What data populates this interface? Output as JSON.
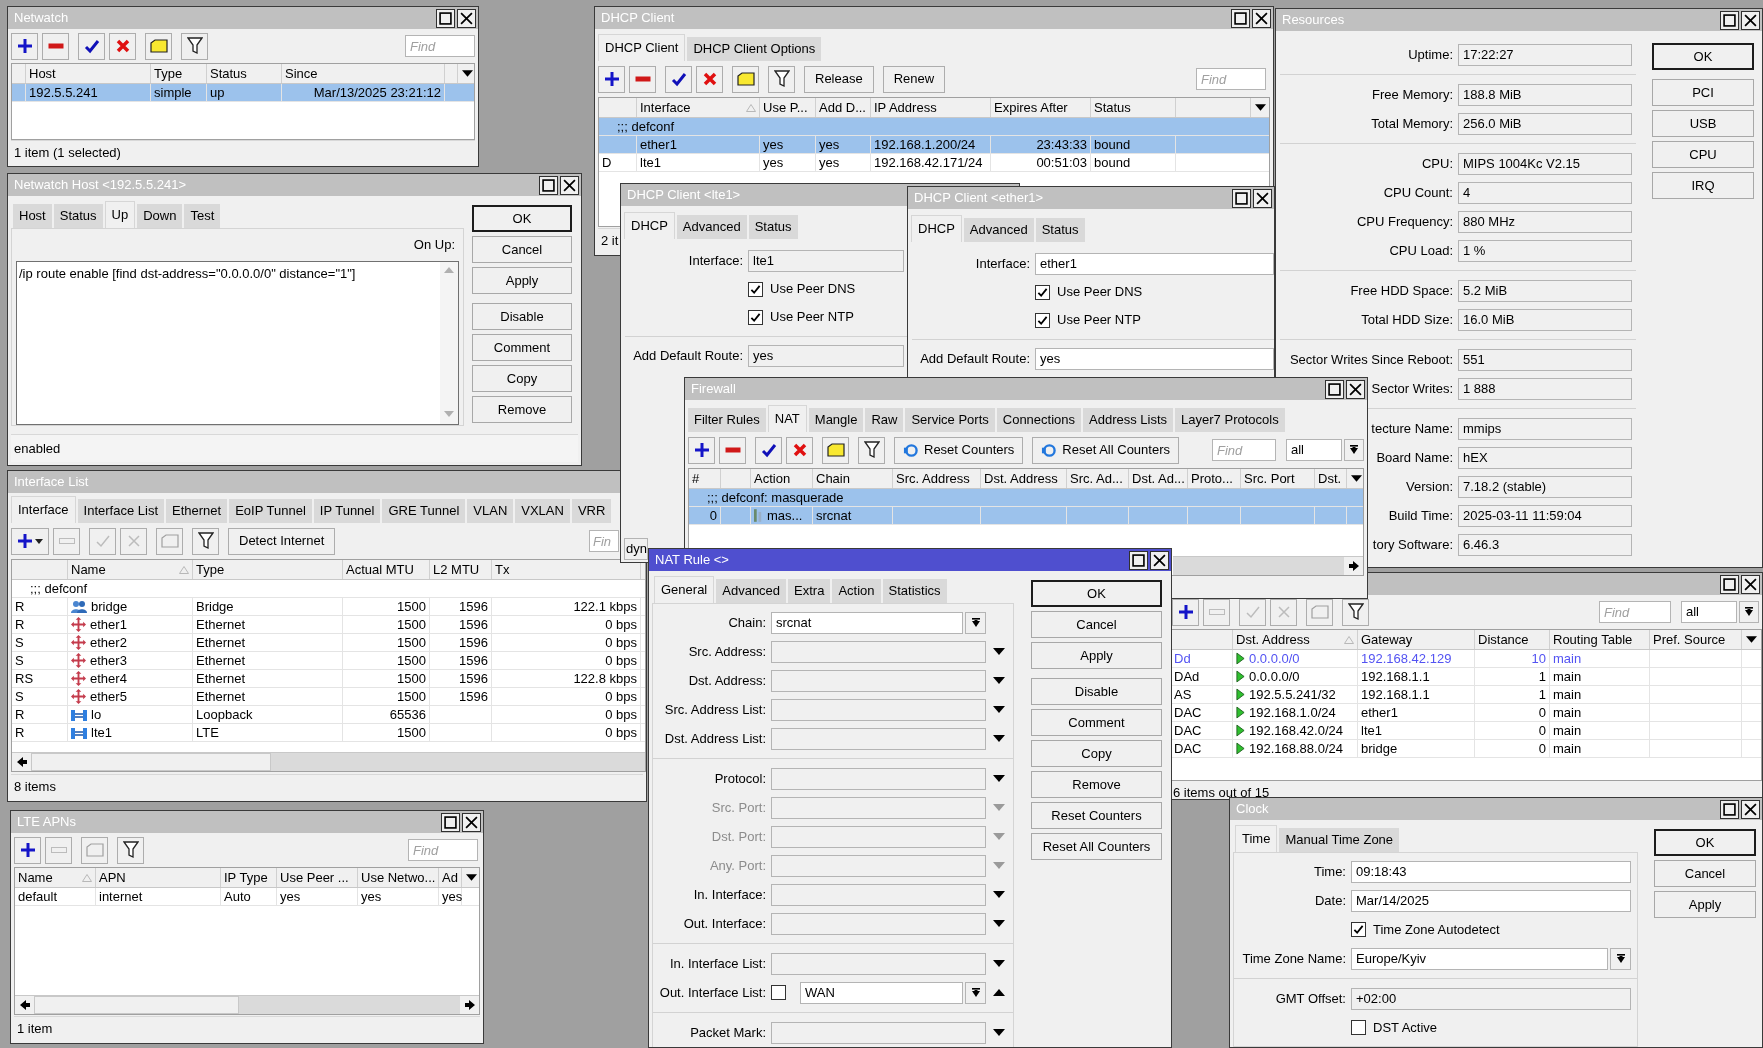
{
  "netwatch": {
    "title": "Netwatch",
    "active": false,
    "toolbar": [
      {
        "kind": "add",
        "disabled": false
      },
      {
        "kind": "remove",
        "disabled": false
      },
      {
        "kind": "enable",
        "disabled": false
      },
      {
        "kind": "disable",
        "disabled": false
      },
      {
        "kind": "comment",
        "disabled": false
      },
      {
        "kind": "filter",
        "disabled": false
      }
    ],
    "find": {
      "placeholder": "Find"
    },
    "columns": [
      {
        "label": "Host",
        "sorted": false
      },
      {
        "label": "Type",
        "sorted": false
      },
      {
        "label": "Status",
        "sorted": false
      },
      {
        "label": "Since",
        "sorted": false
      }
    ],
    "rows": [
      {
        "selected": true,
        "host": "192.5.5.241",
        "type": "simple",
        "status": "up",
        "since": "Mar/13/2025 23:21:12"
      }
    ],
    "status": "1 item (1 selected)"
  },
  "netwatch_host": {
    "title": "Netwatch Host <192.5.5.241>",
    "active": false,
    "tabs": [
      {
        "label": "Host",
        "selected": false
      },
      {
        "label": "Status",
        "selected": false
      },
      {
        "label": "Up",
        "selected": true
      },
      {
        "label": "Down",
        "selected": false
      },
      {
        "label": "Test",
        "selected": false
      }
    ],
    "script": {
      "label": "On Up:",
      "value": "/ip route enable [find dst-address=\"0.0.0.0/0\" distance=\"1\"]"
    },
    "buttons": [
      {
        "label": "OK",
        "default": true
      },
      {
        "label": "Cancel",
        "default": false
      },
      {
        "label": "Apply",
        "default": false
      },
      {
        "label": "Disable",
        "default": false
      },
      {
        "label": "Comment",
        "default": false
      },
      {
        "label": "Copy",
        "default": false
      },
      {
        "label": "Remove",
        "default": false
      }
    ],
    "status": "enabled"
  },
  "dhcp_client": {
    "title": "DHCP Client",
    "active": false,
    "tabs": [
      {
        "label": "DHCP Client",
        "selected": true
      },
      {
        "label": "DHCP Client Options",
        "selected": false
      }
    ],
    "toolbar": [
      {
        "kind": "add",
        "disabled": false
      },
      {
        "kind": "remove",
        "disabled": false
      },
      {
        "kind": "enable",
        "disabled": false
      },
      {
        "kind": "disable",
        "disabled": false
      },
      {
        "kind": "comment",
        "disabled": false
      },
      {
        "kind": "filter",
        "disabled": false
      },
      {
        "kind": "text",
        "label": "Release",
        "disabled": false
      },
      {
        "kind": "text",
        "label": "Renew",
        "disabled": false
      }
    ],
    "find": {
      "placeholder": "Find"
    },
    "columns": [
      {
        "label": "Interface",
        "sorted": true
      },
      {
        "label": "Use P...",
        "sorted": false
      },
      {
        "label": "Add D...",
        "sorted": false
      },
      {
        "label": "IP Address",
        "sorted": false
      },
      {
        "label": "Expires After",
        "sorted": false
      },
      {
        "label": "Status",
        "sorted": false
      }
    ],
    "rows": [
      {
        "kind": "comment",
        "text": ";;; defconf",
        "selected": true
      },
      {
        "kind": "item",
        "selected": true,
        "interface": "ether1",
        "peer": "yes",
        "route": "yes",
        "ip": "192.168.1.200/24",
        "expires": "23:43:33",
        "status": "bound"
      },
      {
        "kind": "item",
        "selected": false,
        "flags": "D",
        "interface": "lte1",
        "peer": "yes",
        "route": "yes",
        "ip": "192.168.42.171/24",
        "expires": "00:51:03",
        "status": "bound"
      }
    ],
    "status": "2 it"
  },
  "interface_list": {
    "title": "Interface List",
    "active": false,
    "tabs": [
      {
        "label": "Interface",
        "selected": true
      },
      {
        "label": "Interface List",
        "selected": false
      },
      {
        "label": "Ethernet",
        "selected": false
      },
      {
        "label": "EoIP Tunnel",
        "selected": false
      },
      {
        "label": "IP Tunnel",
        "selected": false
      },
      {
        "label": "GRE Tunnel",
        "selected": false
      },
      {
        "label": "VLAN",
        "selected": false
      },
      {
        "label": "VXLAN",
        "selected": false
      },
      {
        "label": "VRR",
        "selected": false
      }
    ],
    "toolbar": [
      {
        "kind": "add-menu",
        "disabled": false
      },
      {
        "kind": "remove",
        "disabled": true
      },
      {
        "kind": "enable",
        "disabled": true
      },
      {
        "kind": "disable",
        "disabled": true
      },
      {
        "kind": "comment",
        "disabled": true
      },
      {
        "kind": "filter",
        "disabled": false
      },
      {
        "kind": "text",
        "label": "Detect Internet",
        "disabled": false
      }
    ],
    "find": {
      "placeholder": "Fin"
    },
    "columns": [
      {
        "label": "Name",
        "sorted": true
      },
      {
        "label": "Type",
        "sorted": false
      },
      {
        "label": "Actual MTU",
        "sorted": false
      },
      {
        "label": "L2 MTU",
        "sorted": false
      },
      {
        "label": "Tx",
        "sorted": false
      }
    ],
    "rows": [
      {
        "kind": "comment",
        "text": ";;; defconf",
        "selected": false
      },
      {
        "kind": "bridge",
        "selected": false,
        "flags": "R",
        "name": "bridge",
        "type": "Bridge",
        "mtu": "1500",
        "l2mtu": "1596",
        "tx": "122.1 kbps"
      },
      {
        "kind": "ethernet",
        "selected": false,
        "flags": "R",
        "name": "ether1",
        "type": "Ethernet",
        "mtu": "1500",
        "l2mtu": "1596",
        "tx": "0 bps"
      },
      {
        "kind": "ethernet",
        "selected": false,
        "flags": "S",
        "name": "ether2",
        "type": "Ethernet",
        "mtu": "1500",
        "l2mtu": "1596",
        "tx": "0 bps"
      },
      {
        "kind": "ethernet",
        "selected": false,
        "flags": "S",
        "name": "ether3",
        "type": "Ethernet",
        "mtu": "1500",
        "l2mtu": "1596",
        "tx": "0 bps"
      },
      {
        "kind": "ethernet",
        "selected": false,
        "flags": "RS",
        "name": "ether4",
        "type": "Ethernet",
        "mtu": "1500",
        "l2mtu": "1596",
        "tx": "122.8 kbps"
      },
      {
        "kind": "ethernet",
        "selected": false,
        "flags": "S",
        "name": "ether5",
        "type": "Ethernet",
        "mtu": "1500",
        "l2mtu": "1596",
        "tx": "0 bps"
      },
      {
        "kind": "virtual",
        "selected": false,
        "flags": "R",
        "name": "lo",
        "type": "Loopback",
        "mtu": "65536",
        "tx": "0 bps"
      },
      {
        "kind": "virtual",
        "selected": false,
        "flags": "R",
        "name": "lte1",
        "type": "LTE",
        "mtu": "1500",
        "tx": "0 bps"
      }
    ],
    "status": "8 items"
  },
  "lte_apns": {
    "title": "LTE APNs",
    "active": false,
    "toolbar": [
      {
        "kind": "add",
        "disabled": false
      },
      {
        "kind": "remove",
        "disabled": true
      },
      {
        "kind": "comment",
        "disabled": true
      },
      {
        "kind": "filter",
        "disabled": false
      }
    ],
    "find": {
      "placeholder": "Find"
    },
    "columns": [
      {
        "label": "Name",
        "sorted": true
      },
      {
        "label": "APN",
        "sorted": false
      },
      {
        "label": "IP Type",
        "sorted": false
      },
      {
        "label": "Use Peer ...",
        "sorted": false
      },
      {
        "label": "Use Netwo...",
        "sorted": false
      },
      {
        "label": "Ad",
        "sorted": false
      }
    ],
    "rows": [
      {
        "selected": false,
        "name": "default",
        "apn": "internet",
        "ip_type": "Auto",
        "use_peer": "yes",
        "use_network": "yes",
        "add": "yes"
      }
    ],
    "status": "1 item"
  },
  "dhcp_lte1": {
    "title": "DHCP Client <lte1>",
    "active": false,
    "tabs": [
      {
        "label": "DHCP",
        "selected": true
      },
      {
        "label": "Advanced",
        "selected": false
      },
      {
        "label": "Status",
        "selected": false
      }
    ],
    "sections": [
      {
        "rows": [
          {
            "kind": "text",
            "label": "Interface:",
            "value": "lte1",
            "readonly": true
          },
          {
            "kind": "checkbox",
            "label": "Use Peer DNS",
            "checked": true
          },
          {
            "kind": "checkbox",
            "label": "Use Peer NTP",
            "checked": true
          }
        ]
      },
      {
        "rows": [
          {
            "kind": "text",
            "label": "Add Default Route:",
            "value": "yes",
            "readonly": true
          }
        ]
      }
    ],
    "status": "dyn"
  },
  "dhcp_ether1": {
    "title": "DHCP Client <ether1>",
    "active": false,
    "tabs": [
      {
        "label": "DHCP",
        "selected": true
      },
      {
        "label": "Advanced",
        "selected": false
      },
      {
        "label": "Status",
        "selected": false
      }
    ],
    "sections": [
      {
        "rows": [
          {
            "kind": "text",
            "label": "Interface:",
            "value": "ether1",
            "readonly": false
          },
          {
            "kind": "checkbox",
            "label": "Use Peer DNS",
            "checked": true
          },
          {
            "kind": "checkbox",
            "label": "Use Peer NTP",
            "checked": true
          }
        ]
      },
      {
        "rows": [
          {
            "kind": "text",
            "label": "Add Default Route:",
            "value": "yes",
            "readonly": false
          }
        ]
      }
    ]
  },
  "resources": {
    "title": "Resources",
    "active": false,
    "sections": [
      {
        "rows": [
          {
            "kind": "text",
            "label": "Uptime:",
            "value": "17:22:27",
            "readonly": true
          }
        ]
      },
      {
        "rows": [
          {
            "kind": "text",
            "label": "Free Memory:",
            "value": "188.8 MiB",
            "readonly": true
          },
          {
            "kind": "text",
            "label": "Total Memory:",
            "value": "256.0 MiB",
            "readonly": true
          }
        ]
      },
      {
        "rows": [
          {
            "kind": "text",
            "label": "CPU:",
            "value": "MIPS 1004Kc V2.15",
            "readonly": true
          },
          {
            "kind": "text",
            "label": "CPU Count:",
            "value": "4",
            "readonly": true
          },
          {
            "kind": "text",
            "label": "CPU Frequency:",
            "value": "880 MHz",
            "readonly": true
          },
          {
            "kind": "text",
            "label": "CPU Load:",
            "value": "1 %",
            "readonly": true
          }
        ]
      },
      {
        "rows": [
          {
            "kind": "text",
            "label": "Free HDD Space:",
            "value": "5.2 MiB",
            "readonly": true
          },
          {
            "kind": "text",
            "label": "Total HDD Size:",
            "value": "16.0 MiB",
            "readonly": true
          }
        ]
      },
      {
        "rows": [
          {
            "kind": "text",
            "label": "Sector Writes Since Reboot:",
            "value": "551",
            "readonly": true
          },
          {
            "kind": "text",
            "label": "Sector Writes:",
            "value": "1 888",
            "readonly": true
          }
        ]
      },
      {
        "rows": [
          {
            "kind": "text",
            "label": "tecture Name:",
            "value": "mmips",
            "readonly": true
          },
          {
            "kind": "text",
            "label": "Board Name:",
            "value": "hEX",
            "readonly": true
          },
          {
            "kind": "text",
            "label": "Version:",
            "value": "7.18.2 (stable)",
            "readonly": true
          },
          {
            "kind": "text",
            "label": "Build Time:",
            "value": "2025-03-11 11:59:04",
            "readonly": true
          },
          {
            "kind": "text",
            "label": "tory Software:",
            "value": "6.46.3",
            "readonly": true
          }
        ]
      }
    ],
    "buttons": [
      {
        "label": "OK",
        "default": true
      },
      {
        "label": "PCI",
        "default": false
      },
      {
        "label": "USB",
        "default": false
      },
      {
        "label": "CPU",
        "default": false
      },
      {
        "label": "IRQ",
        "default": false
      }
    ]
  },
  "routes": {
    "active": false,
    "toolbar": [
      {
        "kind": "add",
        "disabled": false
      },
      {
        "kind": "remove",
        "disabled": true
      },
      {
        "kind": "enable",
        "disabled": true
      },
      {
        "kind": "disable",
        "disabled": true
      },
      {
        "kind": "comment",
        "disabled": true
      },
      {
        "kind": "filter",
        "disabled": false
      }
    ],
    "find": {
      "placeholder": "Find"
    },
    "filter": "all",
    "columns": [
      {
        "label": "Dst. Address",
        "sorted": true
      },
      {
        "label": "Gateway",
        "sorted": false
      },
      {
        "label": "Distance",
        "sorted": false
      },
      {
        "label": "Routing Table",
        "sorted": false
      },
      {
        "label": "Pref. Source",
        "sorted": false
      }
    ],
    "rows": [
      {
        "selected": false,
        "color": "#5353f2",
        "flags": "Dd",
        "dst": "0.0.0.0/0",
        "gateway": "192.168.42.129",
        "distance": "10",
        "table": "main"
      },
      {
        "selected": false,
        "color": "#000000",
        "flags": "DAd",
        "dst": "0.0.0.0/0",
        "gateway": "192.168.1.1",
        "distance": "1",
        "table": "main"
      },
      {
        "selected": false,
        "color": "#000000",
        "flags": "AS",
        "dst": "192.5.5.241/32",
        "gateway": "192.168.1.1",
        "distance": "1",
        "table": "main"
      },
      {
        "selected": false,
        "color": "#000000",
        "flags": "DAC",
        "dst": "192.168.1.0/24",
        "gateway": "ether1",
        "distance": "0",
        "table": "main"
      },
      {
        "selected": false,
        "color": "#000000",
        "flags": "DAC",
        "dst": "192.168.42.0/24",
        "gateway": "lte1",
        "distance": "0",
        "table": "main"
      },
      {
        "selected": false,
        "color": "#000000",
        "flags": "DAC",
        "dst": "192.168.88.0/24",
        "gateway": "bridge",
        "distance": "0",
        "table": "main"
      }
    ],
    "status": "6 items out of 15"
  },
  "firewall": {
    "title": "Firewall",
    "active": false,
    "tabs": [
      {
        "label": "Filter Rules",
        "selected": false
      },
      {
        "label": "NAT",
        "selected": true
      },
      {
        "label": "Mangle",
        "selected": false
      },
      {
        "label": "Raw",
        "selected": false
      },
      {
        "label": "Service Ports",
        "selected": false
      },
      {
        "label": "Connections",
        "selected": false
      },
      {
        "label": "Address Lists",
        "selected": false
      },
      {
        "label": "Layer7 Protocols",
        "selected": false
      }
    ],
    "toolbar": [
      {
        "kind": "add",
        "disabled": false
      },
      {
        "kind": "remove",
        "disabled": false
      },
      {
        "kind": "enable",
        "disabled": false
      },
      {
        "kind": "disable",
        "disabled": false
      },
      {
        "kind": "comment",
        "disabled": false
      },
      {
        "kind": "filter",
        "disabled": false
      },
      {
        "kind": "reset",
        "label": "Reset Counters",
        "disabled": false
      },
      {
        "kind": "reset",
        "label": "Reset All Counters",
        "disabled": false
      }
    ],
    "find": {
      "placeholder": "Find"
    },
    "filter": "all",
    "columns": [
      {
        "label": "#",
        "sorted": false
      },
      {
        "label": "Action",
        "sorted": false
      },
      {
        "label": "Chain",
        "sorted": false
      },
      {
        "label": "Src. Address",
        "sorted": false
      },
      {
        "label": "Dst. Address",
        "sorted": false
      },
      {
        "label": "Src. Ad...",
        "sorted": false
      },
      {
        "label": "Dst. Ad...",
        "sorted": false
      },
      {
        "label": "Proto...",
        "sorted": false
      },
      {
        "label": "Src. Port",
        "sorted": false
      },
      {
        "label": "Dst.",
        "sorted": false
      }
    ],
    "rows": [
      {
        "kind": "comment",
        "text": ";;; defconf: masquerade",
        "selected": true
      },
      {
        "kind": "item",
        "selected": true,
        "num": "0",
        "action": "mas...",
        "chain": "srcnat"
      }
    ]
  },
  "clock": {
    "title": "Clock",
    "active": false,
    "tabs": [
      {
        "label": "Time",
        "selected": true
      },
      {
        "label": "Manual Time Zone",
        "selected": false
      }
    ],
    "sections": [
      {
        "rows": [
          {
            "kind": "text",
            "label": "Time:",
            "value": "09:18:43",
            "readonly": false
          },
          {
            "kind": "text",
            "label": "Date:",
            "value": "Mar/14/2025",
            "readonly": false
          },
          {
            "kind": "checkbox",
            "label": "Time Zone Autodetect",
            "checked": true
          },
          {
            "kind": "combo",
            "label": "Time Zone Name:",
            "value": "Europe/Kyiv",
            "disabled": false
          }
        ]
      },
      {
        "rows": [
          {
            "kind": "text",
            "label": "GMT Offset:",
            "value": "+02:00",
            "readonly": true
          },
          {
            "kind": "checkbox",
            "label": "DST Active",
            "checked": false
          }
        ]
      }
    ],
    "buttons": [
      {
        "label": "OK",
        "default": true
      },
      {
        "label": "Cancel",
        "default": false
      },
      {
        "label": "Apply",
        "default": false
      }
    ]
  },
  "nat_rule": {
    "title": "NAT Rule <>",
    "active": true,
    "tabs": [
      {
        "label": "General",
        "selected": true
      },
      {
        "label": "Advanced",
        "selected": false
      },
      {
        "label": "Extra",
        "selected": false
      },
      {
        "label": "Action",
        "selected": false
      },
      {
        "label": "Statistics",
        "selected": false
      }
    ],
    "sections": [
      {
        "rows": [
          {
            "kind": "combo",
            "label": "Chain:",
            "value": "srcnat",
            "disabled": false
          },
          {
            "kind": "select",
            "label": "Src. Address:",
            "disabled": false
          },
          {
            "kind": "select",
            "label": "Dst. Address:",
            "disabled": false
          },
          {
            "kind": "select",
            "label": "Src. Address List:",
            "disabled": false
          },
          {
            "kind": "select",
            "label": "Dst. Address List:",
            "disabled": false
          }
        ]
      },
      {
        "rows": [
          {
            "kind": "select",
            "label": "Protocol:",
            "disabled": false
          },
          {
            "kind": "select",
            "label": "Src. Port:",
            "disabled": true
          },
          {
            "kind": "select",
            "label": "Dst. Port:",
            "disabled": true
          },
          {
            "kind": "select",
            "label": "Any. Port:",
            "disabled": true
          },
          {
            "kind": "select",
            "label": "In. Interface:",
            "disabled": false
          },
          {
            "kind": "select",
            "label": "Out. Interface:",
            "disabled": false
          }
        ]
      },
      {
        "rows": [
          {
            "kind": "select",
            "label": "In. Interface List:",
            "disabled": false
          },
          {
            "kind": "list",
            "label": "Out. Interface List:",
            "value": "WAN",
            "checked": false,
            "disabled": false
          }
        ]
      },
      {
        "rows": [
          {
            "kind": "select",
            "label": "Packet Mark:",
            "disabled": false
          }
        ]
      }
    ],
    "buttons": [
      {
        "label": "OK",
        "default": true
      },
      {
        "label": "Cancel",
        "default": false
      },
      {
        "label": "Apply",
        "default": false
      },
      {
        "label": "Disable",
        "default": false
      },
      {
        "label": "Comment",
        "default": false
      },
      {
        "label": "Copy",
        "default": false
      },
      {
        "label": "Remove",
        "default": false
      },
      {
        "label": "Reset Counters",
        "default": false
      },
      {
        "label": "Reset All Counters",
        "default": false
      }
    ]
  }
}
